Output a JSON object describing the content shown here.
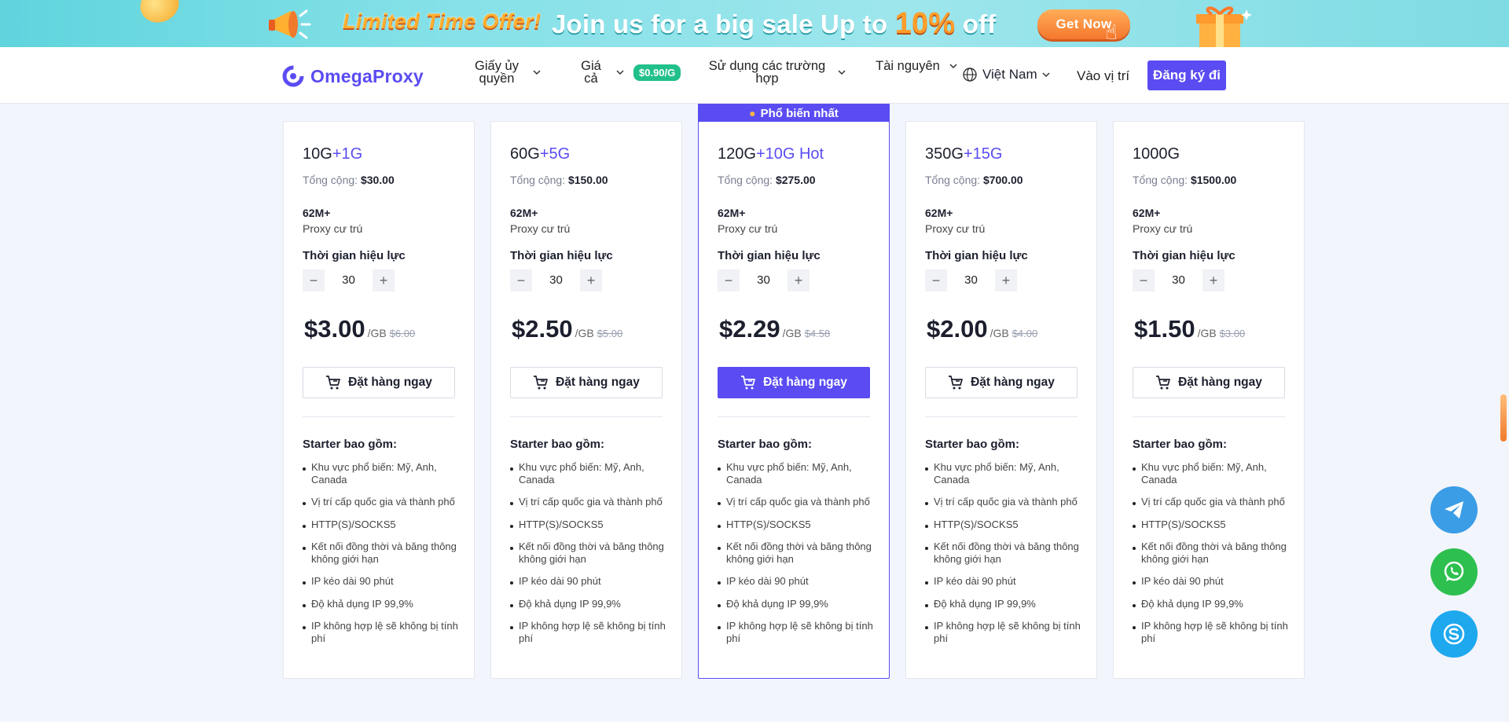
{
  "banner": {
    "offer_text": "Limited Time Offer!",
    "join_text_1": "Join us for a big sale  Up to ",
    "join_pct": "10%",
    "join_text_2": " off",
    "cta_label": "Get Now"
  },
  "header": {
    "logo_text": "OmegaProxy",
    "nav": [
      {
        "label": "Giấy ủy quyền"
      },
      {
        "label": "Giá cả",
        "badge": "$0.90/G"
      },
      {
        "label": "Sử dụng các trường hợp"
      },
      {
        "label": "Tài nguyên"
      }
    ],
    "language": "Việt Nam",
    "signin_label": "Vào vị trí",
    "register_label": "Đăng ký đi"
  },
  "popular_label": "Phổ biến nhất",
  "plans": [
    {
      "title_main": "10G",
      "title_bonus": "+1G",
      "total_label": "Tổng cộng: ",
      "total": "$30.00",
      "ip_count": "62M+",
      "ip_type": "Proxy cư trú",
      "validity_label": "Thời gian hiệu lực",
      "days": "30",
      "price": "$3.00",
      "unit": "/GB",
      "old_price": "$6.00",
      "order_label": "Đặt hàng ngay",
      "includes_label": "Starter bao gồm:",
      "features": [
        "Khu vực phổ biến: Mỹ, Anh, Canada",
        "Vị trí cấp quốc gia và thành phố",
        "HTTP(S)/SOCKS5",
        "Kết nối đồng thời và băng thông không giới hạn",
        "IP kéo dài 90 phút",
        "Độ khả dụng IP 99,9%",
        "IP không hợp lệ sẽ không bị tính phí"
      ]
    },
    {
      "title_main": "60G",
      "title_bonus": "+5G",
      "total_label": "Tổng cộng: ",
      "total": "$150.00",
      "ip_count": "62M+",
      "ip_type": "Proxy cư trú",
      "validity_label": "Thời gian hiệu lực",
      "days": "30",
      "price": "$2.50",
      "unit": "/GB",
      "old_price": "$5.00",
      "order_label": "Đặt hàng ngay",
      "includes_label": "Starter bao gồm:",
      "features": [
        "Khu vực phổ biến: Mỹ, Anh, Canada",
        "Vị trí cấp quốc gia và thành phố",
        "HTTP(S)/SOCKS5",
        "Kết nối đồng thời và băng thông không giới hạn",
        "IP kéo dài 90 phút",
        "Độ khả dụng IP 99,9%",
        "IP không hợp lệ sẽ không bị tính phí"
      ]
    },
    {
      "title_main": "120G",
      "title_bonus": "+10G Hot",
      "total_label": "Tổng cộng: ",
      "total": "$275.00",
      "ip_count": "62M+",
      "ip_type": "Proxy cư trú",
      "validity_label": "Thời gian hiệu lực",
      "days": "30",
      "price": "$2.29",
      "unit": "/GB",
      "old_price": "$4.58",
      "order_label": "Đặt hàng ngay",
      "includes_label": "Starter bao gồm:",
      "features": [
        "Khu vực phổ biến: Mỹ, Anh, Canada",
        "Vị trí cấp quốc gia và thành phố",
        "HTTP(S)/SOCKS5",
        "Kết nối đồng thời và băng thông không giới hạn",
        "IP kéo dài 90 phút",
        "Độ khả dụng IP 99,9%",
        "IP không hợp lệ sẽ không bị tính phí"
      ]
    },
    {
      "title_main": "350G",
      "title_bonus": "+15G",
      "total_label": "Tổng cộng: ",
      "total": "$700.00",
      "ip_count": "62M+",
      "ip_type": "Proxy cư trú",
      "validity_label": "Thời gian hiệu lực",
      "days": "30",
      "price": "$2.00",
      "unit": "/GB",
      "old_price": "$4.00",
      "order_label": "Đặt hàng ngay",
      "includes_label": "Starter bao gồm:",
      "features": [
        "Khu vực phổ biến: Mỹ, Anh, Canada",
        "Vị trí cấp quốc gia và thành phố",
        "HTTP(S)/SOCKS5",
        "Kết nối đồng thời và băng thông không giới hạn",
        "IP kéo dài 90 phút",
        "Độ khả dụng IP 99,9%",
        "IP không hợp lệ sẽ không bị tính phí"
      ]
    },
    {
      "title_main": "1000G",
      "title_bonus": "",
      "total_label": "Tổng cộng: ",
      "total": "$1500.00",
      "ip_count": "62M+",
      "ip_type": "Proxy cư trú",
      "validity_label": "Thời gian hiệu lực",
      "days": "30",
      "price": "$1.50",
      "unit": "/GB",
      "old_price": "$3.00",
      "order_label": "Đặt hàng ngay",
      "includes_label": "Starter bao gồm:",
      "features": [
        "Khu vực phổ biến: Mỹ, Anh, Canada",
        "Vị trí cấp quốc gia và thành phố",
        "HTTP(S)/SOCKS5",
        "Kết nối đồng thời và băng thông không giới hạn",
        "IP kéo dài 90 phút",
        "Độ khả dụng IP 99,9%",
        "IP không hợp lệ sẽ không bị tính phí"
      ]
    }
  ],
  "colors": {
    "accent": "#5a4cf2",
    "badge": "#22c08a",
    "telegram": "#3b9de6",
    "whatsapp": "#2ec04f",
    "skype": "#1ea8ee"
  },
  "float_icons": [
    "telegram-icon",
    "whatsapp-icon",
    "skype-icon"
  ]
}
